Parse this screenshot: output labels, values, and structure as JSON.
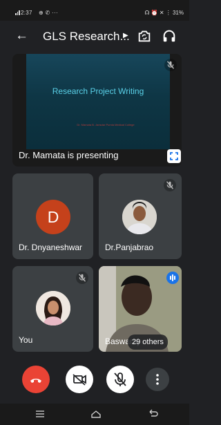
{
  "status_bar": {
    "time": "2:37",
    "left_icons": [
      "signal-icon",
      "whatsapp-icon",
      "phone-icon",
      "more-notifications-icon"
    ],
    "battery": "31%",
    "right_icons": [
      "headset-icon",
      "alarm-icon",
      "mute-icon",
      "wifi-icon",
      "signal-icon",
      "battery-icon"
    ]
  },
  "header": {
    "back_icon": "arrow-back-icon",
    "title": "GLS Research...",
    "switch_camera_icon": "switch-camera-icon",
    "audio_icon": "headphones-icon"
  },
  "presentation": {
    "presenter_label": "Dr. Mamata is presenting",
    "slide_title": "Research Project Writing",
    "slide_subtitle": "Dr. Mamata B. Jansdar\nPurnia Medical College",
    "muted": true,
    "fullscreen_icon": "fullscreen-icon"
  },
  "participants": [
    {
      "name": "Dr. Dnyaneshwar",
      "initial": "D",
      "avatar_color": "#c5411b",
      "muted": false
    },
    {
      "name": "Dr.Panjabrao",
      "muted": true
    },
    {
      "name": "You",
      "muted": true
    },
    {
      "name": "Baswaraj",
      "speaking": true
    }
  ],
  "others_label": "29 others",
  "controls": {
    "end_call_icon": "end-call-icon",
    "camera_icon": "camera-off-icon",
    "mic_icon": "mic-off-icon",
    "more_icon": "more-vert-icon"
  },
  "colors": {
    "background": "#202124",
    "tile": "#3c4043",
    "end_call": "#ea4335",
    "speaking": "#1a73e8",
    "slide_title": "#5ad1e8"
  }
}
